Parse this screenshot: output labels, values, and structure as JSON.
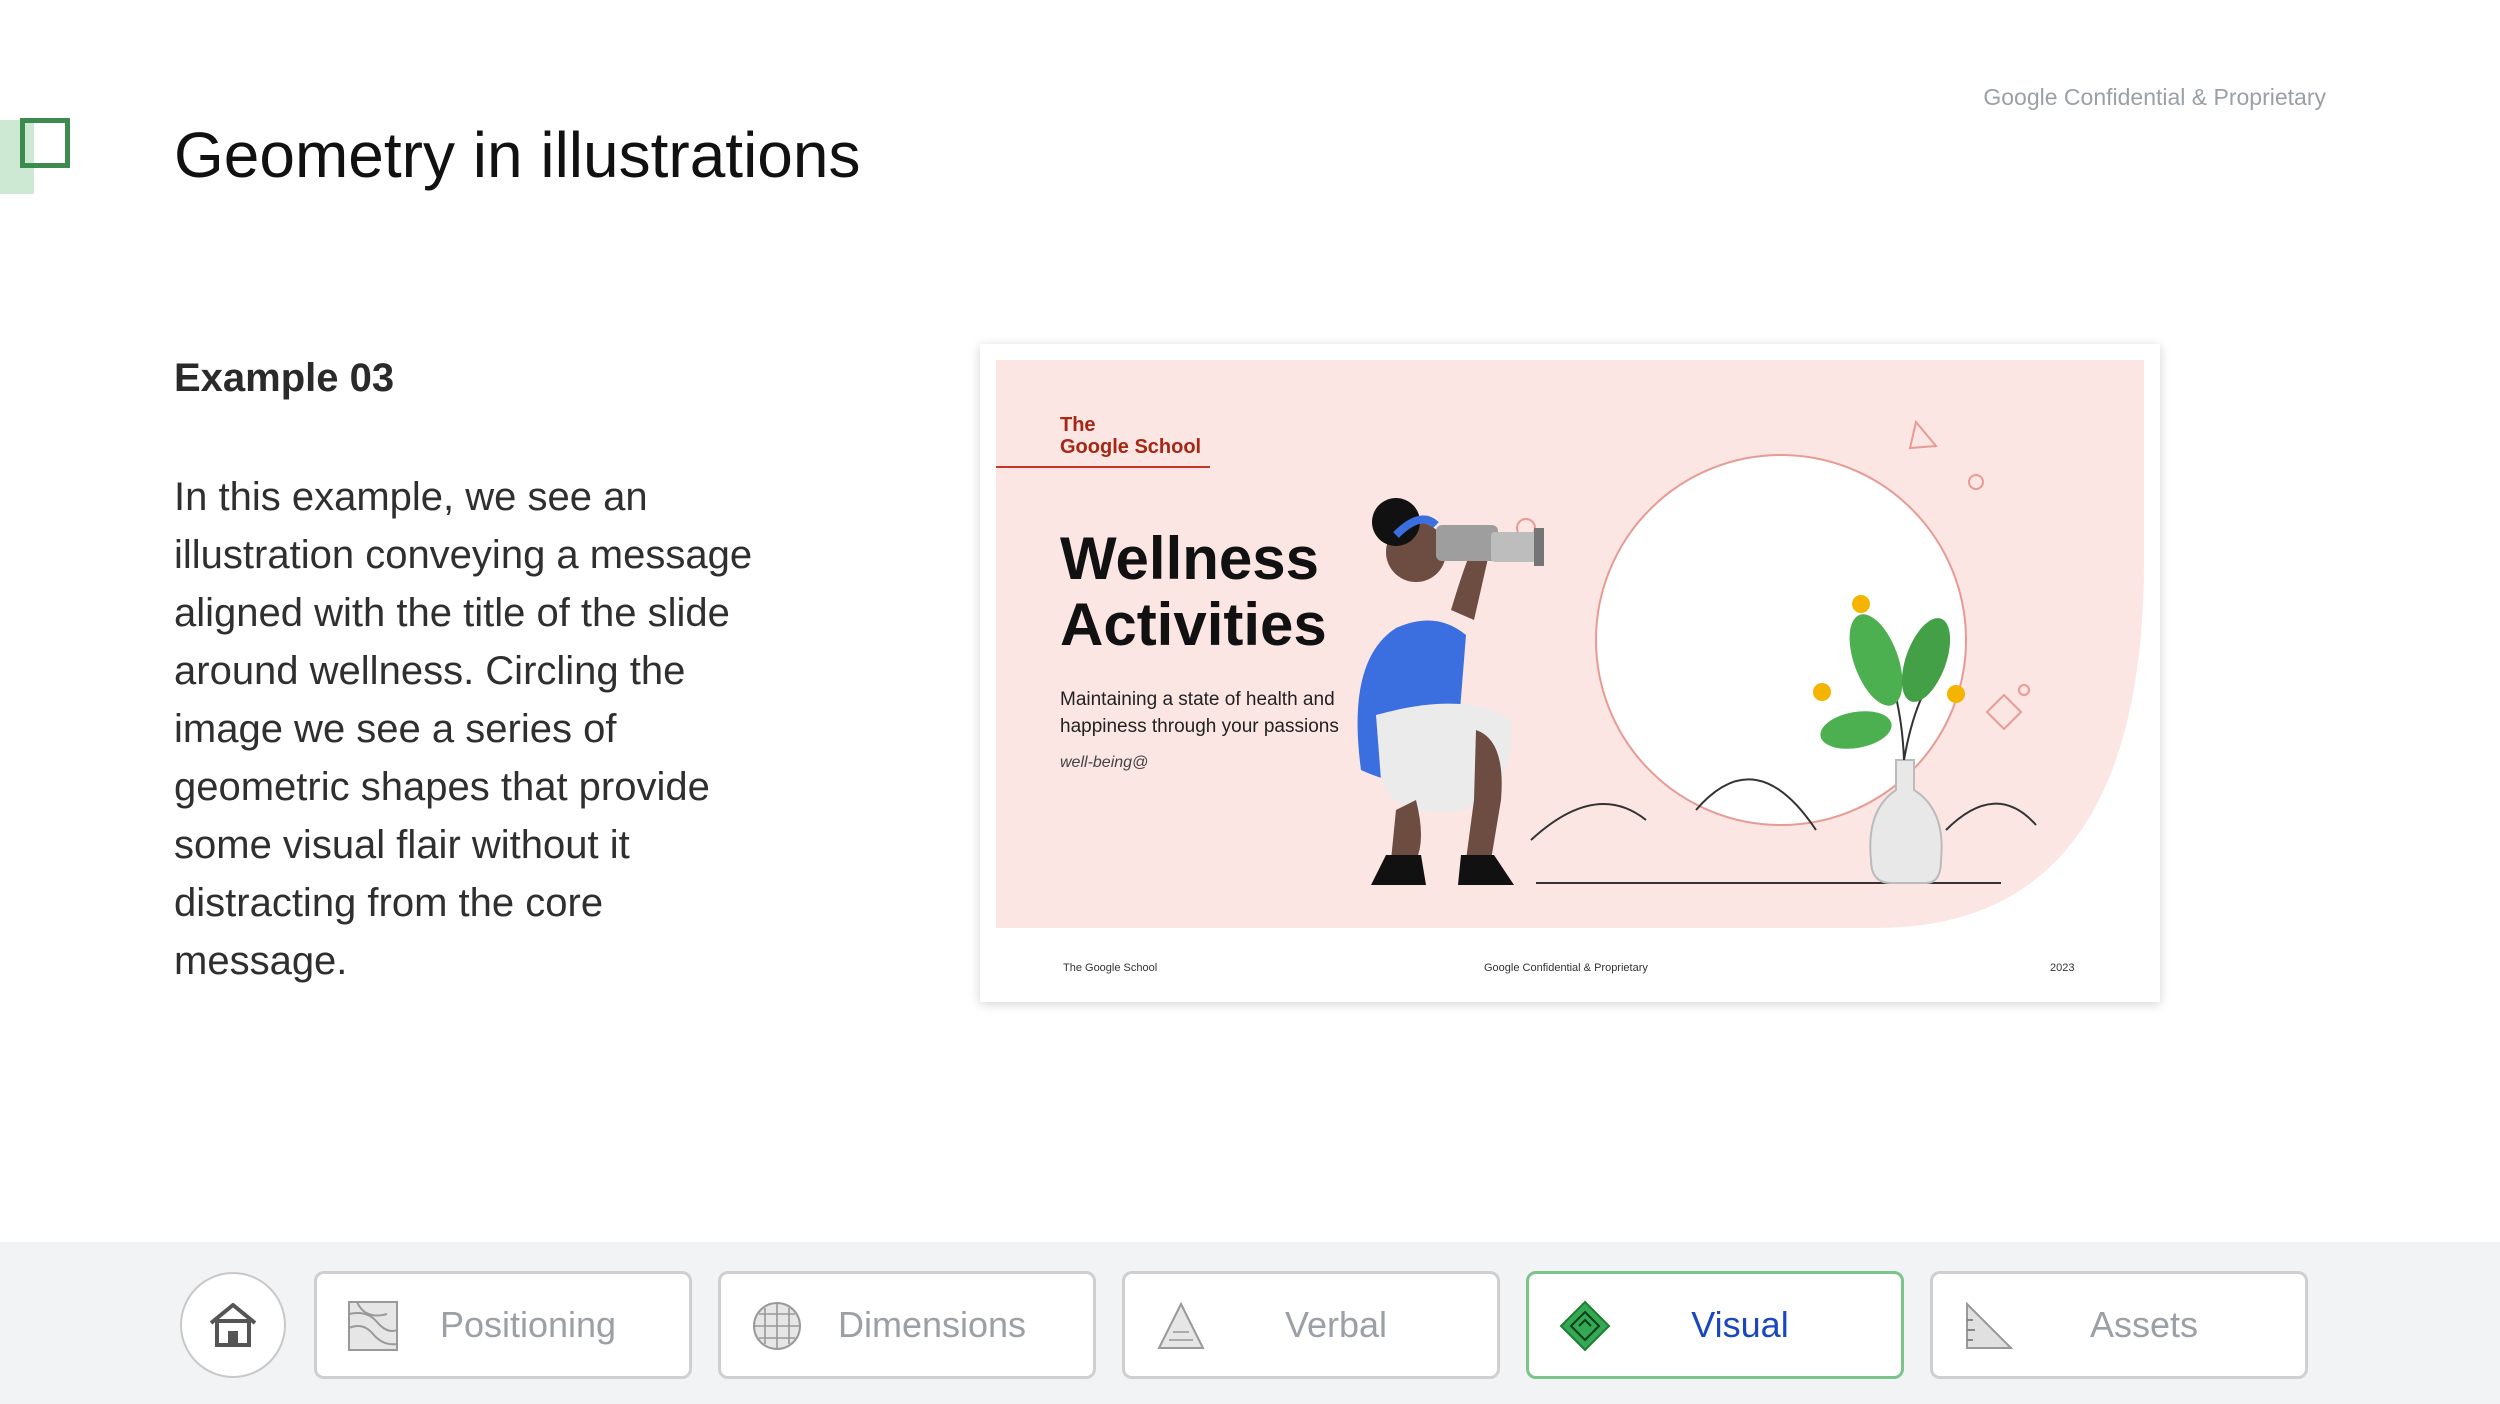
{
  "header": {
    "confidential": "Google Confidential & Proprietary",
    "title": "Geometry in illustrations"
  },
  "content": {
    "example_label": "Example 03",
    "body": "In this example, we see an illustration conveying a message aligned with the title of the slide around wellness. Circling the image we see a series of geometric shapes that provide some visual flair without it distracting from the core message."
  },
  "slide_preview": {
    "brand_line1": "The",
    "brand_line2": "Google School",
    "title_line1": "Wellness",
    "title_line2": "Activities",
    "subtitle": "Maintaining a state of health and happiness through your passions",
    "handle": "well-being@",
    "footer_left": "The Google School",
    "footer_center": "Google Confidential & Proprietary",
    "footer_right": "2023"
  },
  "nav": {
    "home_icon": "home-icon",
    "items": [
      {
        "label": "Positioning",
        "icon": "contour-map-icon",
        "active": false
      },
      {
        "label": "Dimensions",
        "icon": "globe-grid-icon",
        "active": false
      },
      {
        "label": "Verbal",
        "icon": "triangle-icon",
        "active": false
      },
      {
        "label": "Visual",
        "icon": "diamond-maze-icon",
        "active": true
      },
      {
        "label": "Assets",
        "icon": "set-square-icon",
        "active": false
      }
    ]
  },
  "colors": {
    "accent_green": "#3c8a4e",
    "active_text": "#1a47c0",
    "slide_pink": "#fbe6e4",
    "brand_red": "#a52714"
  }
}
